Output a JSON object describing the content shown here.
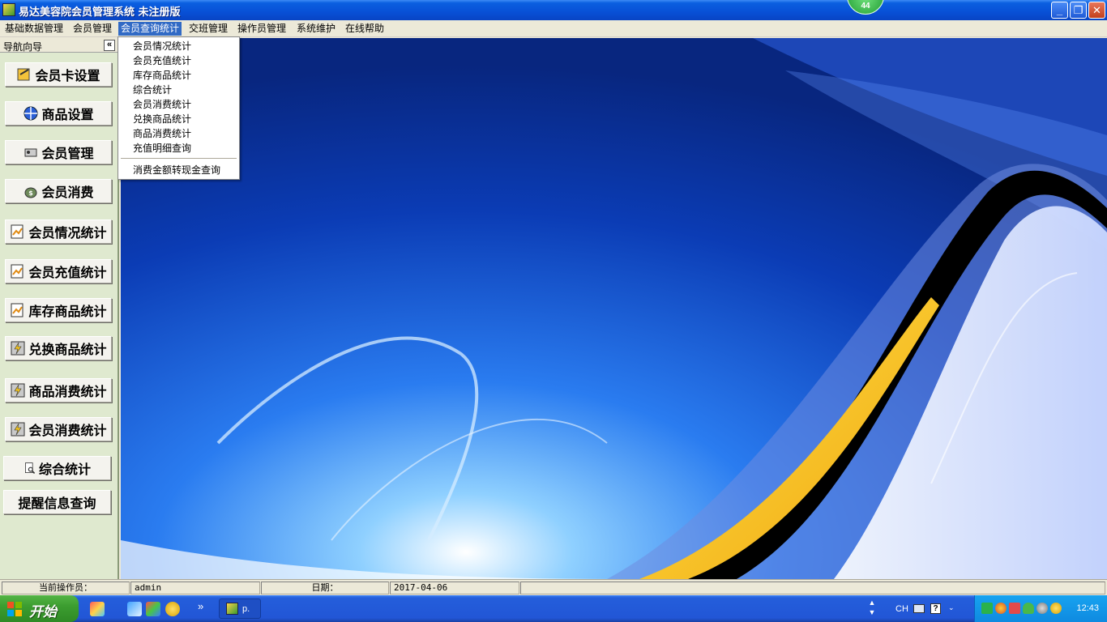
{
  "window": {
    "title": "易达美容院会员管理系统 未注册版",
    "badge_count": "44",
    "minimize_label": "_",
    "restore_label": "❐",
    "close_label": "✕"
  },
  "menubar": {
    "items": [
      "基础数据管理",
      "会员管理",
      "会员查询统计",
      "交班管理",
      "操作员管理",
      "系统维护",
      "在线帮助"
    ]
  },
  "dropdown": {
    "items": [
      "会员情况统计",
      "会员充值统计",
      "库存商品统计",
      "综合统计",
      "会员消费统计",
      "兑换商品统计",
      "商品消费统计",
      "充值明细查询"
    ],
    "extra_item": "消费金额转现金查询"
  },
  "sidebar": {
    "title": "导航向导",
    "collapse_label": "«",
    "buttons": [
      "会员卡设置",
      "商品设置",
      "会员管理",
      "会员消费",
      "会员情况统计",
      "会员充值统计",
      "库存商品统计",
      "兑换商品统计",
      "商品消费统计",
      "会员消费统计",
      "综合统计",
      "提醒信息查询"
    ]
  },
  "statusbar": {
    "operator_label": "当前操作员：",
    "operator_value": "admin",
    "date_label": "日期：",
    "date_value": "2017-04-06"
  },
  "taskbar": {
    "start_label": "开始",
    "window_label": "p.",
    "chevron": "»",
    "lang": "CH",
    "clock": "12:43"
  },
  "colors": {
    "menu_highlight": "#316ac5",
    "titlebar": "#0850d6",
    "start_green": "#3c9d30",
    "background_blue": "#0c3fb4"
  }
}
